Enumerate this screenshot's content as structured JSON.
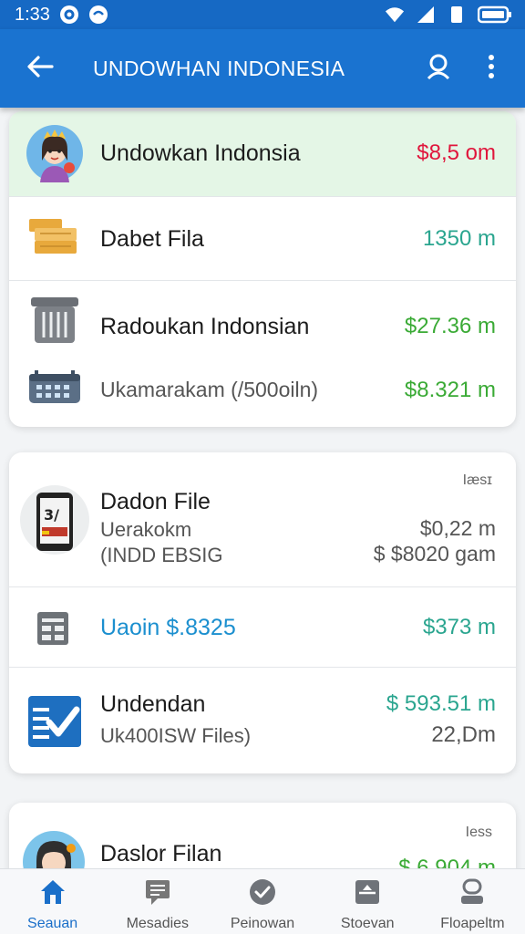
{
  "status_bar": {
    "time": "1:33",
    "icons": [
      "settings-notification-icon",
      "chat-bubble-icon",
      "wifi-icon",
      "signal-icon",
      "battery-icon"
    ]
  },
  "app_bar": {
    "title": "UNDOWHAN INDONESIA",
    "icons": [
      "back-arrow-icon",
      "search-icon",
      "more-vert-icon"
    ]
  },
  "colors": {
    "primary": "#1a73d0",
    "status_bar": "#1669c4",
    "red_amount": "#e0163c",
    "green_amount": "#3aaa35",
    "teal_amount": "#2aa58f",
    "blue_link": "#1b8fcf",
    "highlight_row": "#e4f6e6"
  },
  "card1": {
    "rows": [
      {
        "name": "Undowkan Indonsia",
        "amount": "$8,5 om",
        "icon": "avatar-princess-icon"
      },
      {
        "name": "Dabet Fila",
        "amount": "1350 m",
        "icon": "box-stack-icon"
      },
      {
        "name": "Radoukan Indonsian",
        "amount": "$27.36 m",
        "icon": "trash-bin-icon"
      },
      {
        "name": "Ukamarakam (/500oiln)",
        "amount": "$8.321 m",
        "icon": "calendar-icon"
      }
    ]
  },
  "card2": {
    "rows": [
      {
        "name": "Dadon File",
        "sub1": "Uerakokm",
        "sub2": "(INDD EBSIG",
        "tag": "Iæsɪ",
        "amount1": "$0,22 m",
        "amount2": "$ $8020 gam",
        "icon": "phone-calculator-icon"
      },
      {
        "name": "Uaoin $.8325",
        "amount": "$373 m",
        "icon": "grid-table-icon"
      },
      {
        "name": "Undendan",
        "sub1": "Uk400ISW Files)",
        "amount1": "$ 593.51 m",
        "amount2": "22,Dm",
        "icon": "checklist-icon"
      }
    ]
  },
  "card3": {
    "rows": [
      {
        "name": "Daslor Filan",
        "tag": "Iess",
        "amount": "$ 6.904 m",
        "icon": "avatar-girl-icon"
      }
    ]
  },
  "bottom_nav": {
    "items": [
      {
        "label": "Seauan",
        "icon": "home-icon",
        "active": true
      },
      {
        "label": "Mesadies",
        "icon": "message-icon",
        "active": false
      },
      {
        "label": "Peinowan",
        "icon": "check-circle-icon",
        "active": false
      },
      {
        "label": "Stoevan",
        "icon": "inbox-icon",
        "active": false
      },
      {
        "label": "Floapeltm",
        "icon": "profile-icon",
        "active": false
      }
    ]
  }
}
